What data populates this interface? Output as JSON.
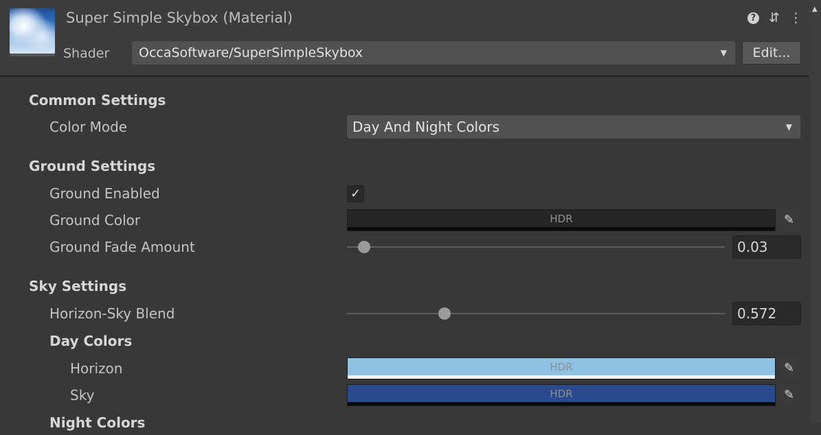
{
  "header": {
    "title": "Super Simple Skybox (Material)",
    "shader_label": "Shader",
    "shader_value": "OccaSoftware/SuperSimpleSkybox",
    "edit_label": "Edit...",
    "icons": [
      "help-icon",
      "presets-icon",
      "more-menu-icon"
    ],
    "help_glyph": "?",
    "presets_glyph": "⇵",
    "more_glyph": "⋮"
  },
  "common": {
    "heading": "Common Settings",
    "color_mode_label": "Color Mode",
    "color_mode_value": "Day And Night Colors"
  },
  "ground": {
    "heading": "Ground Settings",
    "enabled_label": "Ground Enabled",
    "enabled_checked": true,
    "check_glyph": "✓",
    "color_label": "Ground Color",
    "color_hdr": "HDR",
    "color_hex": "#262626",
    "fade_label": "Ground Fade Amount",
    "fade_value": "0.03",
    "fade_slider_fraction": 0.045
  },
  "sky": {
    "heading": "Sky Settings",
    "blend_label": "Horizon-Sky Blend",
    "blend_value": "0.572",
    "blend_slider_fraction": 0.258,
    "day_heading": "Day Colors",
    "horizon_label": "Horizon",
    "horizon_hdr": "HDR",
    "horizon_hex": "#8ec3e6",
    "sky_label": "Sky",
    "sky_hdr": "HDR",
    "sky_hex": "#2a4a8f",
    "night_heading": "Night Colors"
  }
}
